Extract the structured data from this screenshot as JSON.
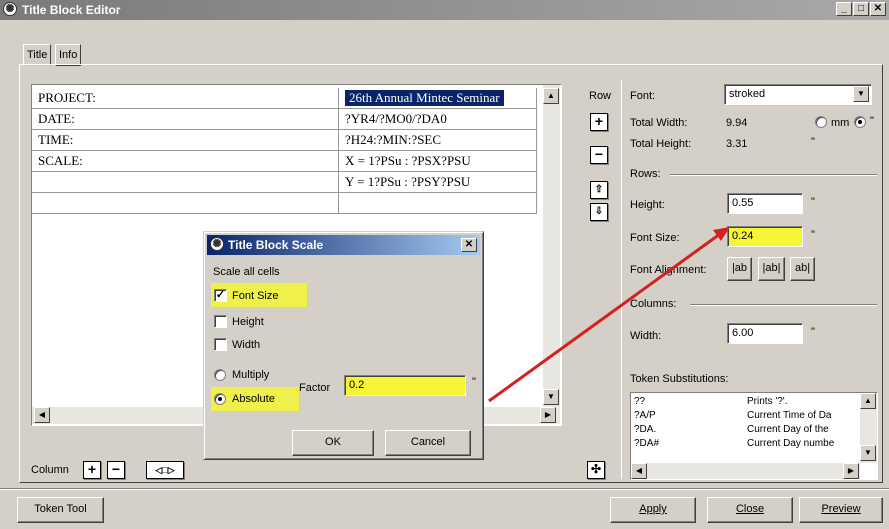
{
  "window": {
    "title": "Title Block Editor"
  },
  "tabs": [
    {
      "label": "Title"
    },
    {
      "label": "Info"
    }
  ],
  "grid": {
    "rows": [
      {
        "label": "PROJECT:",
        "value": "26th Annual Mintec Seminar"
      },
      {
        "label": "DATE:",
        "value": "?YR4/?MO0/?DA0"
      },
      {
        "label": "TIME:",
        "value": "?H24:?MIN:?SEC"
      },
      {
        "label": "SCALE:",
        "value": "X = 1?PSu : ?PSX?PSU"
      },
      {
        "label": "",
        "value": "Y = 1?PSu : ?PSY?PSU"
      },
      {
        "label": "",
        "value": ""
      }
    ]
  },
  "row_controls": {
    "label": "Row"
  },
  "column_controls": {
    "label": "Column"
  },
  "panel": {
    "font_label": "Font:",
    "font_value": "stroked",
    "total_width_label": "Total Width:",
    "total_width_value": "9.94",
    "total_height_label": "Total Height:",
    "total_height_value": "3.31",
    "unit_mm": "mm",
    "unit_inch": "\"",
    "rows_label": "Rows:",
    "height_label": "Height:",
    "height_value": "0.55",
    "font_size_label": "Font Size:",
    "font_size_value": "0.24",
    "font_alignment_label": "Font Alignment:",
    "align_left": "|ab",
    "align_center": "|ab|",
    "align_right": "ab|",
    "columns_label": "Columns:",
    "width_label": "Width:",
    "width_value": "6.00",
    "token_label": "Token Substitutions:",
    "tokens": [
      {
        "code": "??",
        "desc": "Prints '?'."
      },
      {
        "code": "?A/P",
        "desc": "Current Time of Da"
      },
      {
        "code": "?DA.",
        "desc": "Current Day of the"
      },
      {
        "code": "?DA#",
        "desc": "Current Day numbe"
      }
    ]
  },
  "dialog": {
    "title": "Title Block Scale",
    "scale_all": "Scale all cells",
    "font_size": "Font Size",
    "height": "Height",
    "width": "Width",
    "multiply": "Multiply",
    "absolute": "Absolute",
    "factor_label": "Factor",
    "factor_value": "0.2",
    "ok": "OK",
    "cancel": "Cancel"
  },
  "bottom": {
    "token_tool": "Token Tool",
    "apply": "Apply",
    "close": "Close",
    "preview": "Preview"
  },
  "colors": {
    "highlight": "#f5f536",
    "arrow": "#d42020",
    "selection": "#0a246a"
  }
}
